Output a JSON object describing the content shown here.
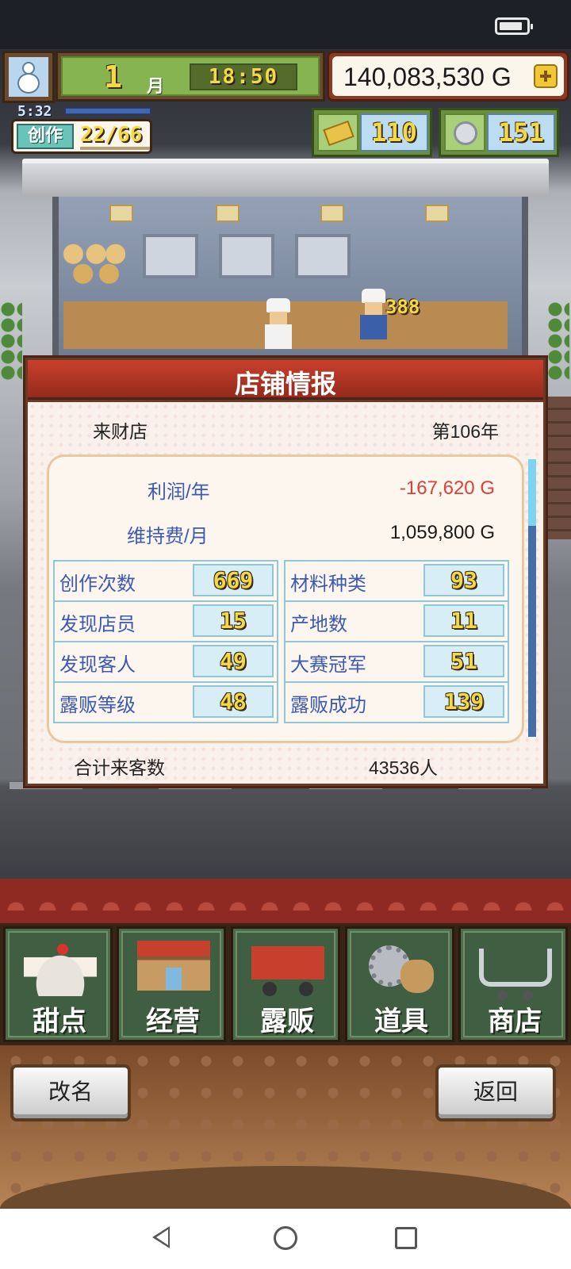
{
  "hud": {
    "month": "1",
    "month_label": "月",
    "time": "18:50",
    "money": "140,083,530 G",
    "create_timer": "5:32",
    "create_label": "创作",
    "create_count": "22/66",
    "tickets": "110",
    "medals": "151"
  },
  "scene": {
    "score_popup": "388"
  },
  "dialog": {
    "title": "店铺情报",
    "shop_name": "来财店",
    "year": "第106年",
    "profit_label": "利润/年",
    "profit_value": "-167,620 G",
    "upkeep_label": "维持费/月",
    "upkeep_value": "1,059,800 G",
    "stats_left": [
      {
        "label": "创作次数",
        "value": "669"
      },
      {
        "label": "发现店员",
        "value": "15"
      },
      {
        "label": "发现客人",
        "value": "49"
      },
      {
        "label": "露贩等级",
        "value": "48"
      }
    ],
    "stats_right": [
      {
        "label": "材料种类",
        "value": "93"
      },
      {
        "label": "产地数",
        "value": "11"
      },
      {
        "label": "大赛冠军",
        "value": "51"
      },
      {
        "label": "露贩成功",
        "value": "139"
      }
    ],
    "total_label": "合计来客数",
    "total_value": "43536人"
  },
  "menu": [
    {
      "label": "甜点",
      "icon": "cake-icon"
    },
    {
      "label": "经营",
      "icon": "shop-icon"
    },
    {
      "label": "露贩",
      "icon": "food-truck-icon"
    },
    {
      "label": "道具",
      "icon": "tools-icon"
    },
    {
      "label": "商店",
      "icon": "cart-icon"
    }
  ],
  "buttons": {
    "rename": "改名",
    "back": "返回"
  },
  "colors": {
    "title_red": "#c8402d",
    "stat_blue": "#3c59b4",
    "negative_red": "#d9413a",
    "pixel_gold": "#f3d94a"
  }
}
